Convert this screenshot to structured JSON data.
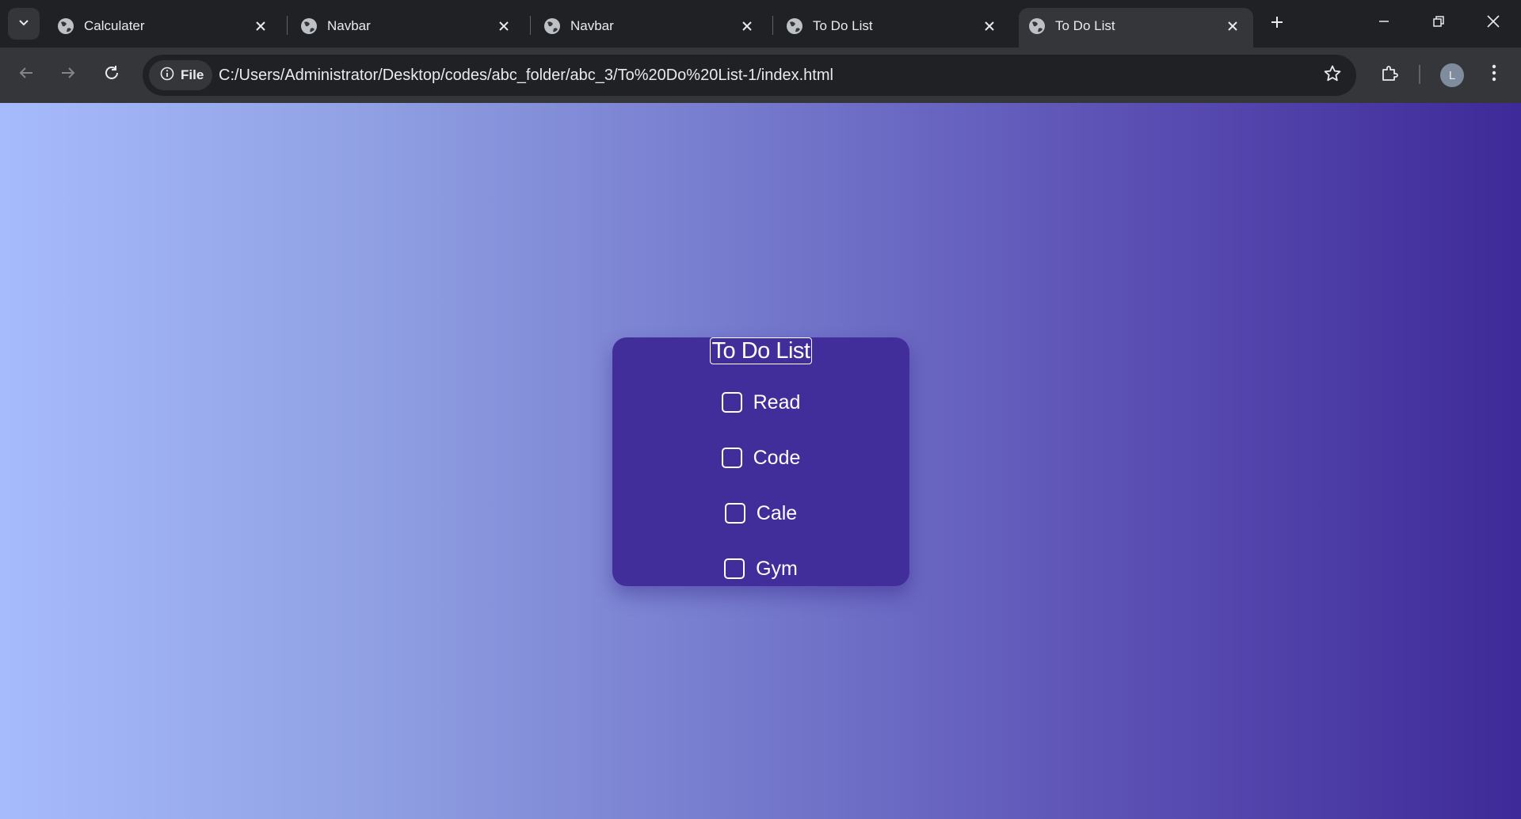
{
  "browser": {
    "tabs": [
      {
        "title": "Calculater",
        "active": false
      },
      {
        "title": "Navbar",
        "active": false
      },
      {
        "title": "Navbar",
        "active": false
      },
      {
        "title": "To Do List",
        "active": false
      },
      {
        "title": "To Do List",
        "active": true
      }
    ],
    "omnibox": {
      "scheme_chip": "File",
      "url": "C:/Users/Administrator/Desktop/codes/abc_folder/abc_3/To%20Do%20List-1/index.html"
    },
    "profile_initial": "L"
  },
  "page": {
    "title": "To Do List",
    "items": [
      {
        "label": "Read",
        "checked": false
      },
      {
        "label": "Code",
        "checked": false
      },
      {
        "label": "Cale",
        "checked": false
      },
      {
        "label": "Gym",
        "checked": false
      }
    ]
  },
  "colors": {
    "card": "#412e9a",
    "gradient_start": "#a6bbfc",
    "gradient_end": "#3e2a98"
  }
}
